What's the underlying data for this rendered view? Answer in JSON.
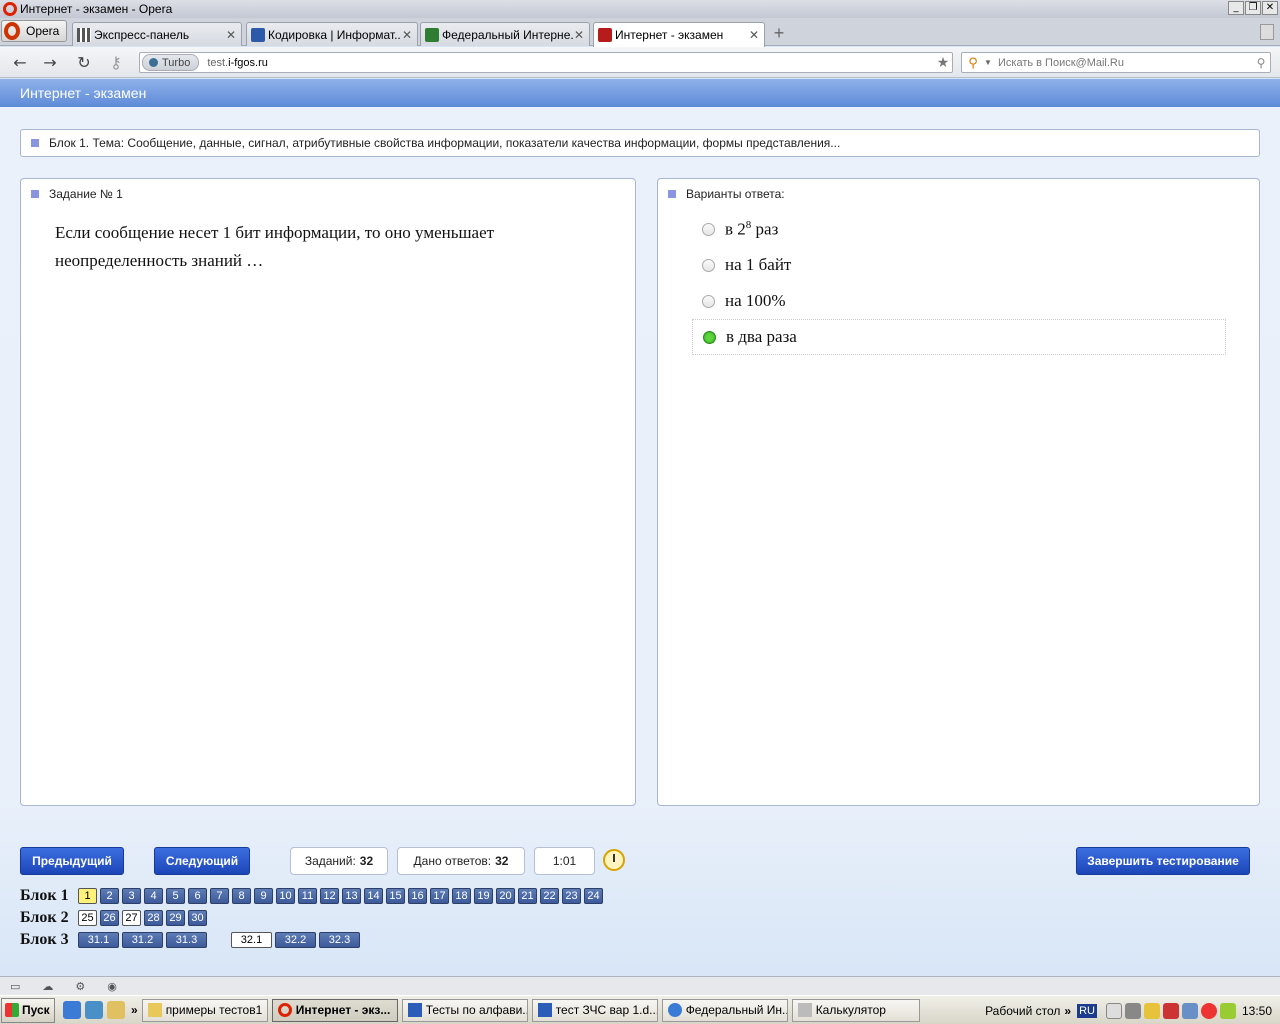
{
  "window": {
    "title": "Интернет - экзамен - Opera",
    "controls": [
      "_",
      "❐",
      "✕"
    ]
  },
  "opera_menu": {
    "label": "Opera"
  },
  "tabs": [
    {
      "label": "Экспресс-панель",
      "icon": "grid-icon",
      "close": "✕"
    },
    {
      "label": "Кодировка | Информат...",
      "icon": "site-icon",
      "close": "✕"
    },
    {
      "label": "Федеральный Интерне...",
      "icon": "site-icon",
      "close": "✕"
    },
    {
      "label": "Интернет - экзамен",
      "icon": "site-icon",
      "close": "✕",
      "active": true
    }
  ],
  "nav": {
    "back": "←",
    "forward": "→",
    "reload": "↻",
    "key": "⚷",
    "turbo_label": "Turbo",
    "url_prefix": "test.",
    "url_host": "i-fgos.ru",
    "bookmark": "★",
    "search_placeholder": "Искать в Поиск@Mail.Ru"
  },
  "page": {
    "header": "Интернет - экзамен",
    "block_title": "Блок 1. Тема: Сообщение, данные, сигнал, атрибутивные свойства информации, показатели качества информации, формы представления...",
    "task_title": "Задание № 1",
    "question": "Если сообщение несет 1 бит информации, то оно уменьшает неопределенность знаний …",
    "answers_title": "Варианты ответа:",
    "answers": [
      {
        "text": "в 2",
        "sup": "8",
        "tail": " раз",
        "selected": false
      },
      {
        "text": "на 1 байт",
        "sup": "",
        "tail": "",
        "selected": false
      },
      {
        "text": "на 100%",
        "sup": "",
        "tail": "",
        "selected": false
      },
      {
        "text": "в два раза",
        "sup": "",
        "tail": "",
        "selected": true
      }
    ]
  },
  "controls": {
    "prev": "Предыдущий",
    "next": "Следующий",
    "tasks_label": "Заданий:",
    "tasks_count": "32",
    "answered_label": "Дано ответов:",
    "answered_count": "32",
    "timer": "1:01",
    "finish": "Завершить тестирование"
  },
  "blocks": [
    {
      "label": "Блок 1",
      "items": [
        "1",
        "2",
        "3",
        "4",
        "5",
        "6",
        "7",
        "8",
        "9",
        "10",
        "11",
        "12",
        "13",
        "14",
        "15",
        "16",
        "17",
        "18",
        "19",
        "20",
        "21",
        "22",
        "23",
        "24"
      ]
    },
    {
      "label": "Блок 2",
      "items": [
        "25",
        "26",
        "27",
        "28",
        "29",
        "30"
      ]
    },
    {
      "label": "Блок 3",
      "items": [
        "31.1",
        "31.2",
        "31.3",
        "32.1",
        "32.2",
        "32.3"
      ]
    }
  ],
  "taskbar": {
    "start": "Пуск",
    "buttons": [
      "примеры тестов1",
      "Интернет - экз...",
      "Тесты по алфави...",
      "тест ЗЧС вар 1.d...",
      "Федеральный Ин...",
      "Калькулятор"
    ],
    "desktop": "Рабочий стол",
    "lang": "RU",
    "clock": "13:50",
    "chevron": "»"
  },
  "colors": {
    "header_gradient_top": "#8fb1e8",
    "header_gradient_bottom": "#5e8bd9",
    "button_blue": "#2a56cc",
    "current_task": "#fff17a",
    "selected_radio": "#3cb52a"
  }
}
